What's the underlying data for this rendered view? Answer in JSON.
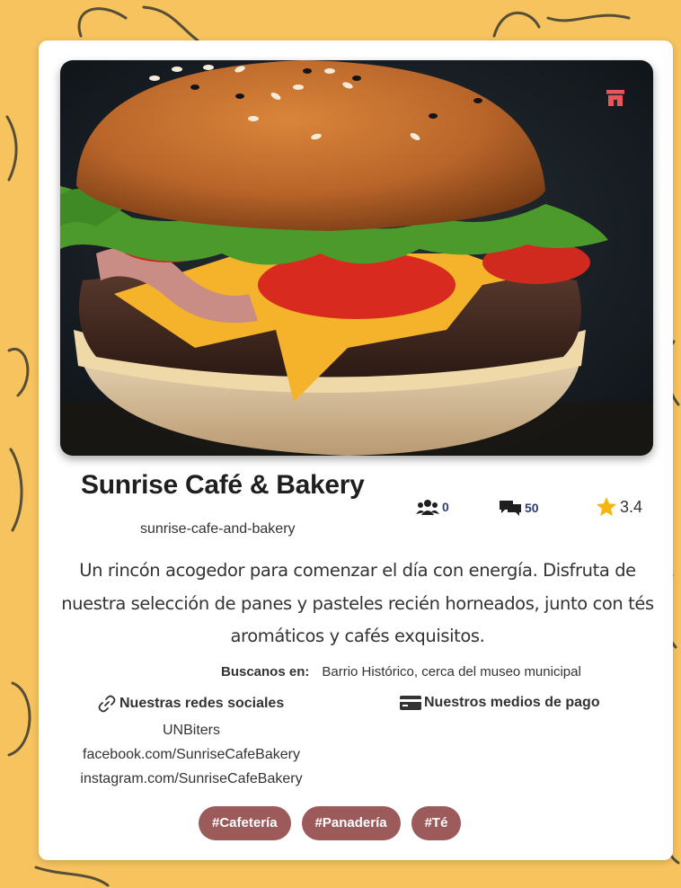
{
  "restaurant": {
    "name": "Sunrise Café & Bakery",
    "slug": "sunrise-cafe-and-bakery",
    "description": "Un rincón acogedor para comenzar el día con energía. Disfruta de nuestra selección de panes y pasteles recién horneados, junto con tés aromáticos y cafés exquisitos.",
    "image_icon": "store-icon"
  },
  "stats": {
    "followers": "0",
    "reviews": "50",
    "rating": "3.4",
    "followers_icon": "users-icon",
    "reviews_icon": "comments-icon",
    "rating_icon": "star-icon"
  },
  "location": {
    "label": "Buscanos en:",
    "value": "Barrio Histórico, cerca del museo municipal"
  },
  "social": {
    "title": "Nuestras redes sociales",
    "icon": "link-icon",
    "items": [
      "UNBiters",
      "facebook.com/SunriseCafeBakery",
      "instagram.com/SunriseCafeBakery"
    ]
  },
  "payment": {
    "title": "Nuestros medios de pago",
    "icon": "credit-card-icon"
  },
  "tags": [
    "#Cafetería",
    "#Panadería",
    "#Té"
  ],
  "colors": {
    "background": "#f6c35e",
    "tag": "#9c5a5a",
    "stat_accent": "#2d3e78",
    "star": "#f5b50a",
    "store_icon": "#e8555a"
  }
}
